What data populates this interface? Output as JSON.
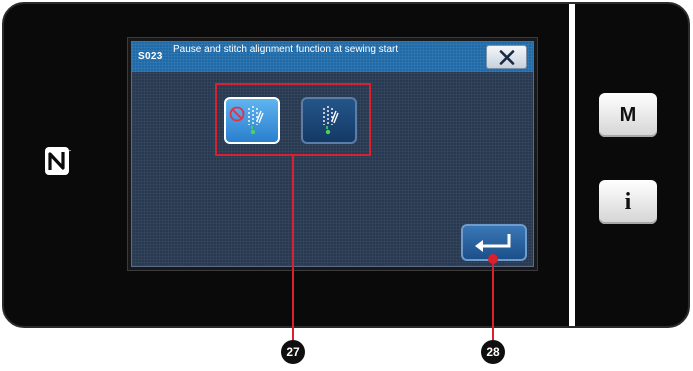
{
  "dialog": {
    "code": "S023",
    "title": "Pause and stitch alignment function at sewing start"
  },
  "side_buttons": {
    "mode_label": "M",
    "info_label": "i"
  },
  "callouts": {
    "options_marker": "27",
    "enter_marker": "28"
  },
  "icons": {
    "close": "close-icon",
    "enter": "enter-arrow-icon",
    "nfc": "nfc-icon",
    "option_on": "stitch-alignment-on-icon",
    "option_off": "stitch-alignment-off-icon"
  },
  "colors": {
    "title_bar": "#1f6aa8",
    "dialog_body": "#283a52",
    "highlight": "#d9202c",
    "selected_button": "#3f99e0"
  },
  "selected_option": 0
}
